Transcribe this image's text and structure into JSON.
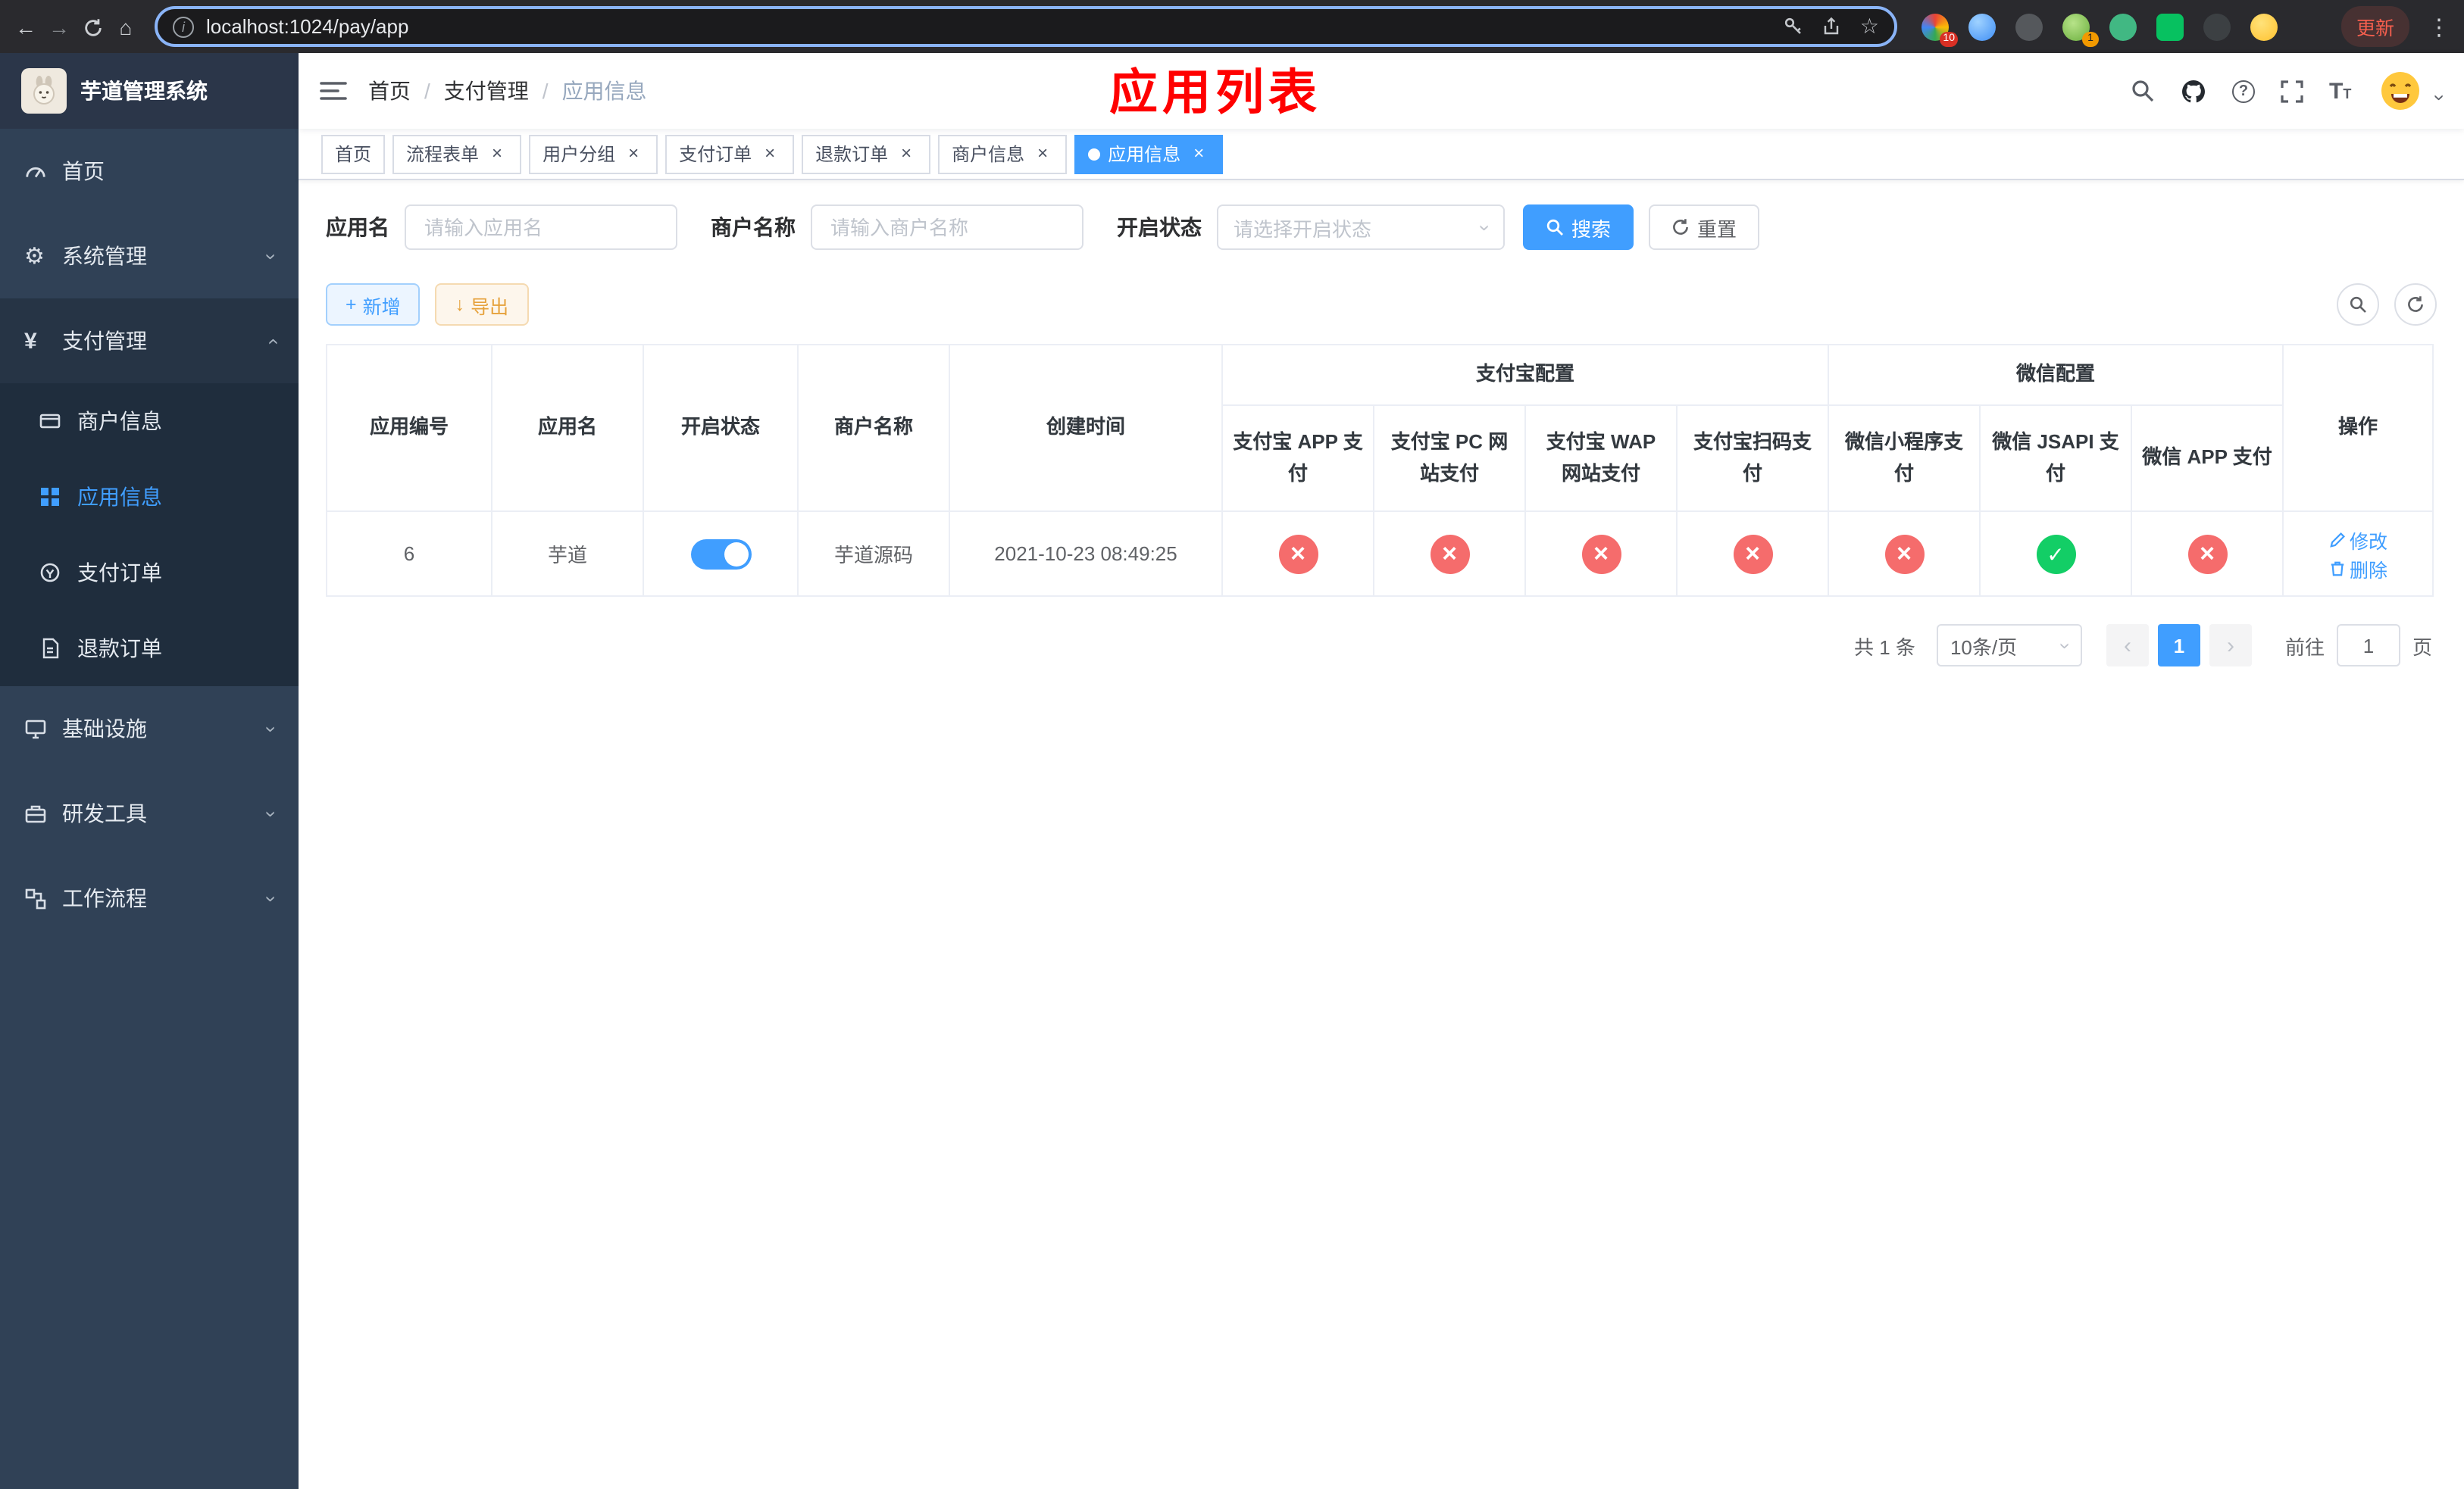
{
  "icons": {
    "back": "←",
    "forward": "→",
    "home": "⌂",
    "star": "☆",
    "menu_dots": "⋮",
    "chevron": "›",
    "angle_left": "‹",
    "angle_right": "›",
    "close": "×",
    "plus": "+",
    "download": "↓",
    "yen": "¥",
    "gear": "⚙",
    "question": "?",
    "info": "i",
    "font_big": "T",
    "font_small": "T",
    "check": "✓",
    "cross": "×"
  },
  "colors": {
    "accent": "#409eff",
    "danger": "#f56c6c",
    "success": "#13ce66",
    "annotation": "#ff0000"
  },
  "browser": {
    "url": "localhost:1024/pay/app",
    "update_label": "更新",
    "ext_badges": {
      "apps": "10",
      "profile": "1"
    }
  },
  "sidebar": {
    "title": "芋道管理系统",
    "menu": [
      {
        "label": "首页"
      },
      {
        "label": "系统管理"
      },
      {
        "label": "支付管理"
      },
      {
        "label": "商户信息"
      },
      {
        "label": "应用信息"
      },
      {
        "label": "支付订单"
      },
      {
        "label": "退款订单"
      },
      {
        "label": "基础设施"
      },
      {
        "label": "研发工具"
      },
      {
        "label": "工作流程"
      }
    ]
  },
  "header": {
    "breadcrumb": {
      "home": "首页",
      "section": "支付管理",
      "current": "应用信息"
    },
    "separator": "/",
    "annotation": "应用列表"
  },
  "tabs": [
    {
      "label": "首页"
    },
    {
      "label": "流程表单"
    },
    {
      "label": "用户分组"
    },
    {
      "label": "支付订单"
    },
    {
      "label": "退款订单"
    },
    {
      "label": "商户信息"
    },
    {
      "label": "应用信息"
    }
  ],
  "filters": {
    "app_name_label": "应用名",
    "app_name_placeholder": "请输入应用名",
    "merchant_label": "商户名称",
    "merchant_placeholder": "请输入商户名称",
    "status_label": "开启状态",
    "status_placeholder": "请选择开启状态",
    "search_label": "搜索",
    "reset_label": "重置"
  },
  "toolbar": {
    "add_label": "新增",
    "export_label": "导出"
  },
  "table": {
    "groups": {
      "alipay": "支付宝配置",
      "wechat": "微信配置"
    },
    "columns": {
      "id": "应用编号",
      "name": "应用名",
      "status": "开启状态",
      "merchant": "商户名称",
      "created": "创建时间",
      "alipay_app": "支付宝 APP 支付",
      "alipay_pc": "支付宝 PC 网站支付",
      "alipay_wap": "支付宝 WAP 网站支付",
      "alipay_qr": "支付宝扫码支付",
      "wx_mini": "微信小程序支付",
      "wx_jsapi": "微信 JSAPI 支付",
      "wx_app": "微信 APP 支付",
      "actions": "操作"
    },
    "row": {
      "id": "6",
      "name": "芋道",
      "enabled": true,
      "merchant": "芋道源码",
      "created": "2021-10-23 08:49:25",
      "alipay_app": false,
      "alipay_pc": false,
      "alipay_wap": false,
      "alipay_qr": false,
      "wx_mini": false,
      "wx_jsapi": true,
      "wx_app": false,
      "edit_label": "修改",
      "delete_label": "删除"
    }
  },
  "pagination": {
    "total": "共 1 条",
    "page_size": "10条/页",
    "page": "1",
    "goto_label": "前往",
    "goto_value": "1",
    "unit_label": "页"
  }
}
